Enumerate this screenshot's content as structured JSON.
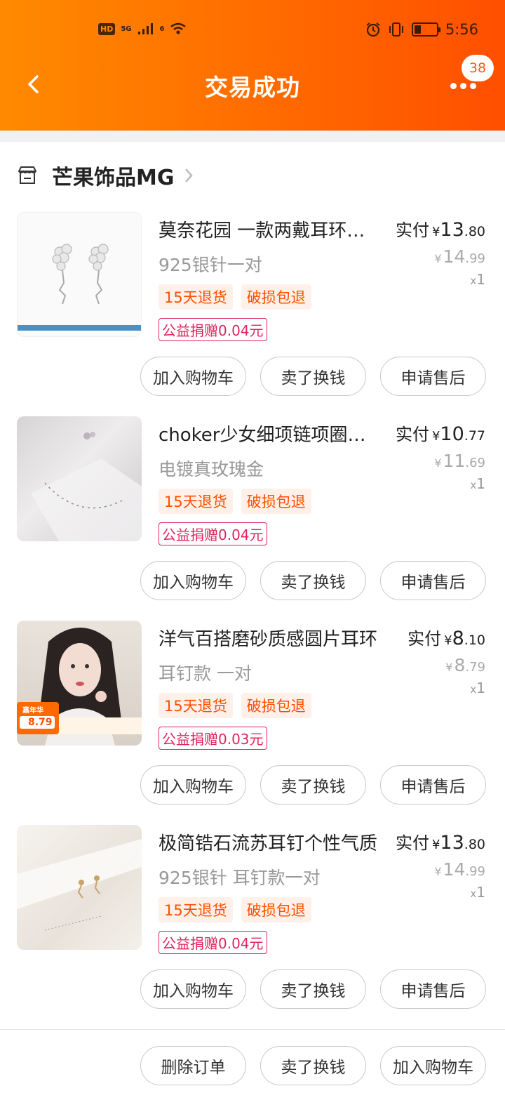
{
  "status_bar": {
    "hd": "HD",
    "net1": "5G",
    "net2": "6",
    "time": "5:56",
    "battery_level": 0.3
  },
  "header": {
    "title": "交易成功",
    "badge_count": "38",
    "icons": {
      "back": "back-chevron-icon",
      "more": "more-dots-icon"
    }
  },
  "shop": {
    "name": "芒果饰品MG",
    "icon": "store-icon"
  },
  "paid_label": "实付",
  "currency": "¥",
  "qty_prefix": "x",
  "tags": [
    "15天退货",
    "破损包退"
  ],
  "items": [
    {
      "title": "莫奈花园 一款两戴耳环气质优雅",
      "sku": "925银针一对",
      "paid_int": "13",
      "paid_dec": ".80",
      "orig_int": "14",
      "orig_dec": ".99",
      "qty": "1",
      "donation": "公益捐赠0.04元",
      "thumb_desc": "earrings"
    },
    {
      "title": "choker少女细项链项圈锁骨链",
      "sku": "电镀真玫瑰金",
      "paid_int": "10",
      "paid_dec": ".77",
      "orig_int": "11",
      "orig_dec": ".69",
      "qty": "1",
      "donation": "公益捐赠0.04元",
      "thumb_desc": "necklace"
    },
    {
      "title": "洋气百搭磨砂质感圆片耳环",
      "sku": "耳钉款 一对",
      "paid_int": "8",
      "paid_dec": ".10",
      "orig_int": "8",
      "orig_dec": ".79",
      "qty": "1",
      "donation": "公益捐赠0.03元",
      "thumb_desc": "model",
      "promo_price": "8.79",
      "promo_label": "嘉年华"
    },
    {
      "title": "极简锆石流苏耳钉个性气质",
      "sku": "925银针 耳钉款一对",
      "paid_int": "13",
      "paid_dec": ".80",
      "orig_int": "14",
      "orig_dec": ".99",
      "qty": "1",
      "donation": "公益捐赠0.04元",
      "thumb_desc": "stud"
    }
  ],
  "item_buttons": [
    "加入购物车",
    "卖了换钱",
    "申请售后"
  ],
  "footer_buttons": [
    "删除订单",
    "卖了换钱",
    "加入购物车"
  ]
}
